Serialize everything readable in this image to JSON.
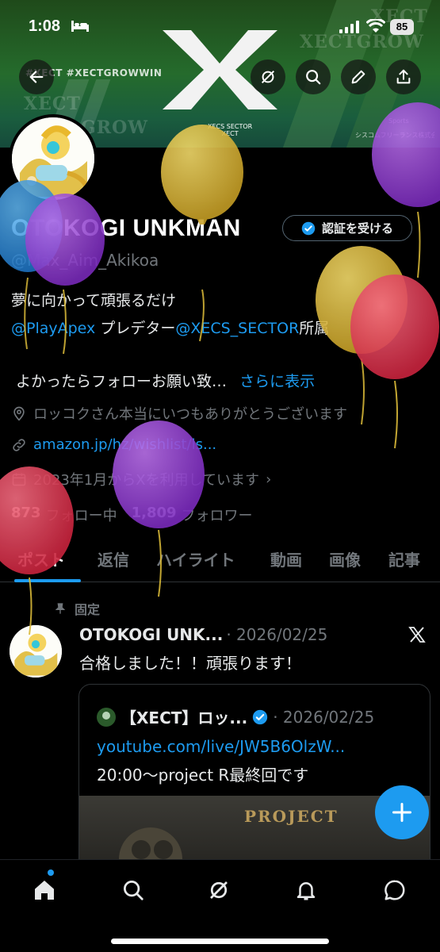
{
  "status_bar": {
    "time": "1:08",
    "battery": "85"
  },
  "banner": {
    "hashtags": "#XECT  #XECTGROWWIN",
    "ghost_top_1": "XECT",
    "ghost_top_2": "XECTGROW",
    "ghost_left_1": "XECT",
    "ghost_left_2": "GROW",
    "sector_text": "XECS SECTOR\nXECT",
    "sponsor_1": "Sports",
    "sponsor_2": "シスコムフリーランス株式会社"
  },
  "header_buttons": {
    "back": "back-arrow-icon",
    "grok": "grok-icon",
    "search": "search-icon",
    "edit": "pencil-icon",
    "share": "share-icon"
  },
  "profile": {
    "name": "OTOKOGI UNKMAN",
    "handle": "@Max_Aim_Akikoa",
    "verify_label": "認証を受ける",
    "bio_line1": "夢に向かって頑張るだけ",
    "bio_link1": "@PlayApex",
    "bio_mid": " プレデター",
    "bio_link2": "@XECS_SECTOR",
    "bio_end": "所属",
    "bio_line3": "よかったらフォローお願い致…",
    "show_more": "さらに表示",
    "location": "ロッコクさん本当にいつもありがとうございます",
    "website": "amazon.jp/hz/wishlist/ls...",
    "joined": "2023年1月からXを利用しています",
    "following_count": "873",
    "following_label": "フォロー中",
    "followers_count": "1,809",
    "followers_label": "フォロワー"
  },
  "tabs": [
    "ポスト",
    "返信",
    "ハイライト",
    "動画",
    "画像",
    "記事"
  ],
  "pinned_post": {
    "pinned_label": "固定",
    "author": "OTOKOGI UNK...",
    "date": "· 2026/02/25",
    "text": "合格しました！！頑張ります！",
    "quote": {
      "author": "【XECT】ロッ...",
      "date": "· 2026/02/25",
      "link": "youtube.com/live/JW5B6OlzW...",
      "text": "20:00〜project R最終回です",
      "media_title": "PROJECT"
    }
  },
  "bottom_nav": [
    "home-icon",
    "search-icon",
    "grok-icon",
    "notifications-icon",
    "messages-icon"
  ],
  "colors": {
    "accent": "#1d9bf0",
    "background": "#000000",
    "muted": "#71767b"
  }
}
